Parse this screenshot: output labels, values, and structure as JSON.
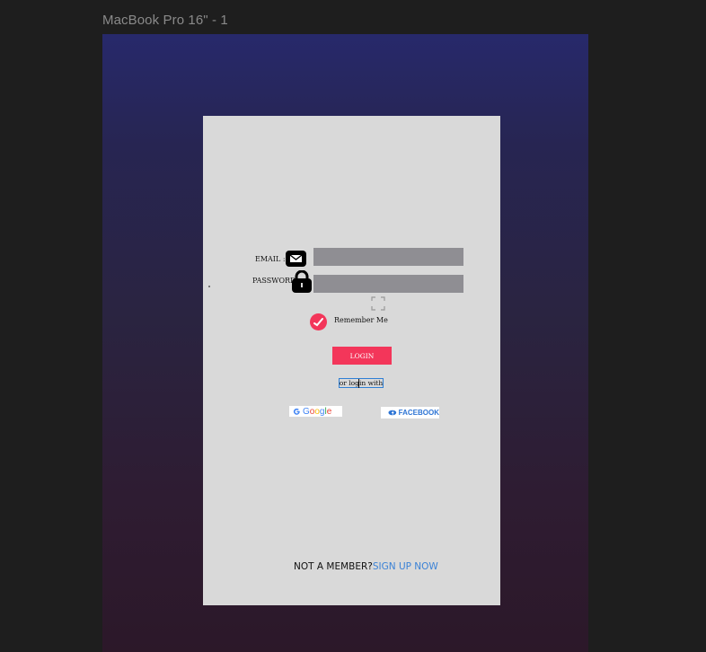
{
  "frame": {
    "title": "MacBook Pro 16\" - 1"
  },
  "login": {
    "email_label": "EMAIL :",
    "password_label": "PASSWORD:",
    "email_value": "",
    "password_value": "",
    "remember_label": "Remember Me",
    "login_button": "LOGIN",
    "or_login_with": "or login with",
    "google_label": "Google",
    "facebook_label": "FACEBOOK",
    "signup_prompt": "NOT A MEMBER?",
    "signup_link": "SIGN UP NOW"
  },
  "icons": {
    "email": "mail-icon",
    "password": "lock-icon",
    "expand": "expand-icon",
    "remember": "check-icon",
    "google": "google-logo",
    "facebook": "facebook-icon"
  },
  "colors": {
    "card": "#d9d9d9",
    "field": "#8f8e93",
    "accent": "#f3365a",
    "link": "#3b82d6",
    "facebook": "#2d74d4"
  }
}
